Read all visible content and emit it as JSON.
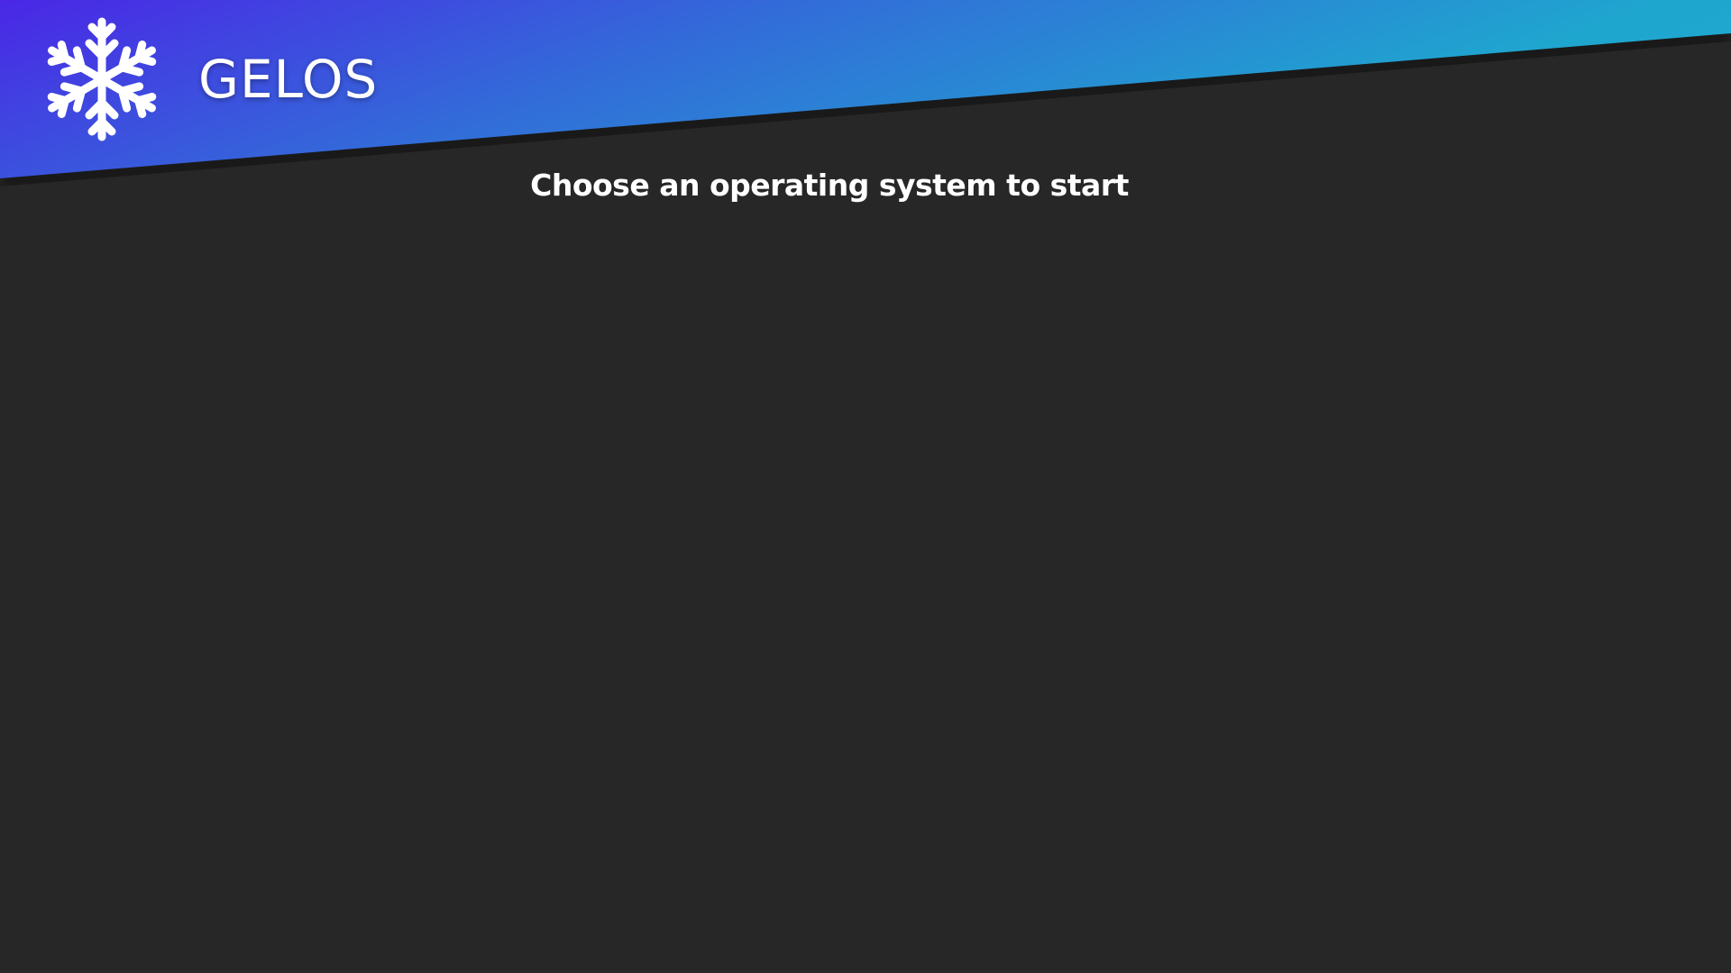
{
  "header": {
    "brand_name": "GELOS",
    "logo_icon": "snowflake-icon",
    "gradient_colors": [
      "#4a27e6",
      "#336ad9",
      "#1fa6cf"
    ]
  },
  "main": {
    "prompt": "Choose an operating system to start",
    "os_options": []
  },
  "colors": {
    "background": "#272727",
    "text": "#ffffff"
  }
}
